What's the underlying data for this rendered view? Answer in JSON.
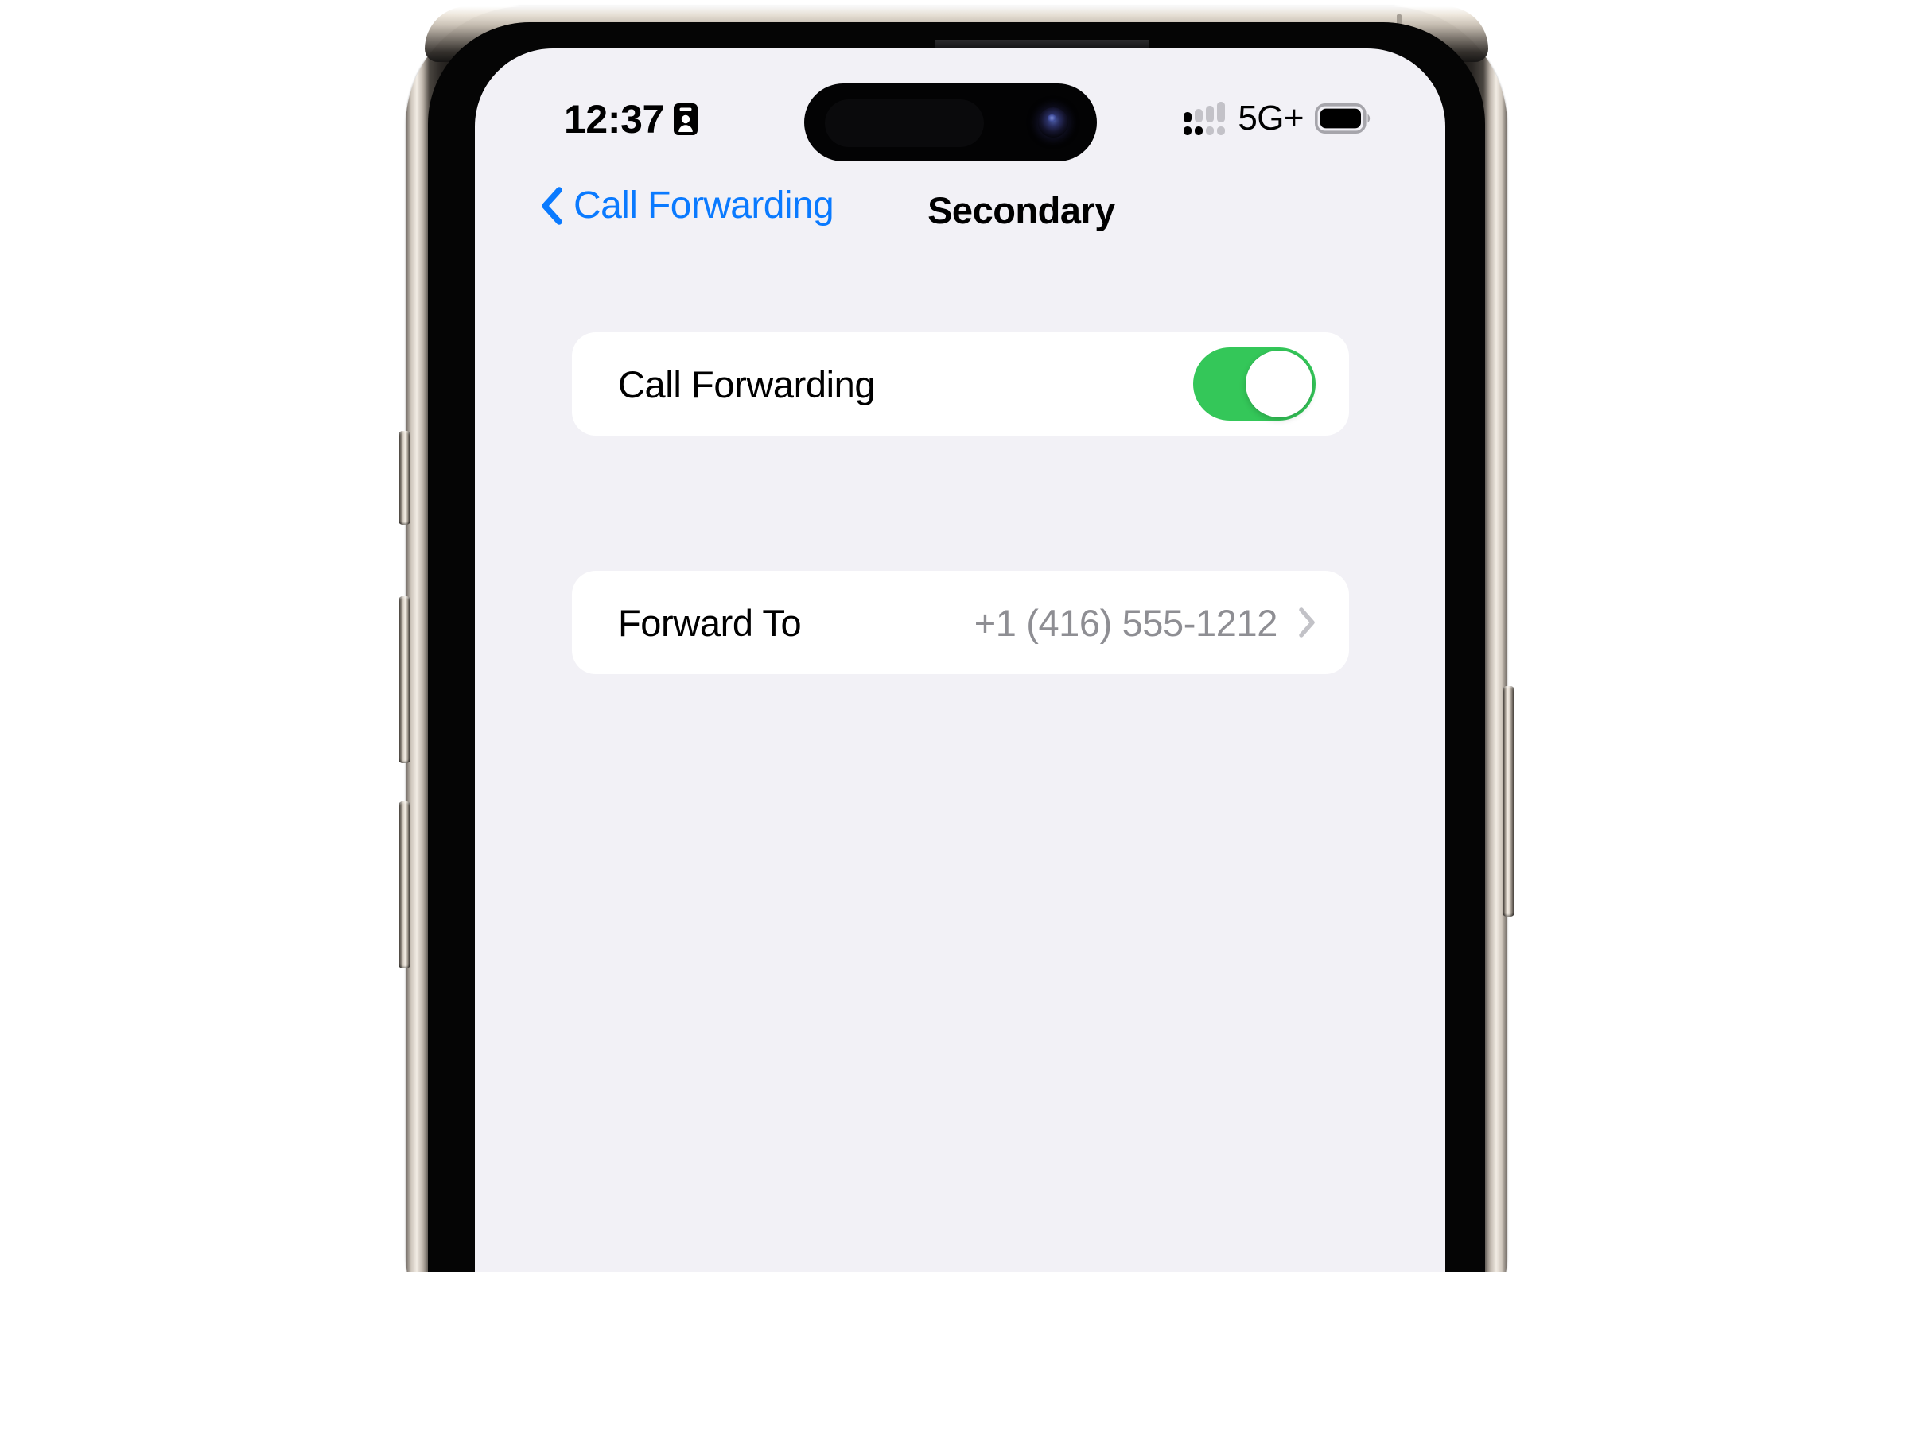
{
  "device": {
    "name": "iphone-15-pro",
    "frame_color": "#cfc7bd",
    "bezel_color": "#050505",
    "buttons": [
      {
        "name": "action-button",
        "side": "left"
      },
      {
        "name": "volume-up-button",
        "side": "left"
      },
      {
        "name": "volume-down-button",
        "side": "left"
      },
      {
        "name": "power-button",
        "side": "right"
      }
    ]
  },
  "status_bar": {
    "time": "12:37",
    "time_badge_icon": "person-badge-icon",
    "signal_icon": "dual-sim-signal-icon",
    "signal_bars_active": 1,
    "signal_dots_active": 2,
    "network_label": "5G+",
    "battery_icon": "battery-full-icon",
    "battery_level_percent": 100
  },
  "nav_bar": {
    "back_icon": "chevron-left-icon",
    "back_label": "Call Forwarding",
    "title": "Secondary",
    "back_color": "#0a7aff"
  },
  "content": {
    "background_color": "#f2f1f6",
    "card_color": "#ffffff",
    "groups": [
      {
        "id": "call-forwarding-group",
        "rows": [
          {
            "type": "toggle",
            "label": "Call Forwarding",
            "value": "on",
            "toggle_on": true,
            "toggle_color": "#34c759"
          }
        ]
      },
      {
        "id": "forward-to-group",
        "rows": [
          {
            "type": "disclosure",
            "label": "Forward To",
            "value": "+1 (416) 555-1212",
            "value_color": "#8e8e93",
            "accessory_icon": "chevron-right-icon"
          }
        ]
      }
    ]
  }
}
